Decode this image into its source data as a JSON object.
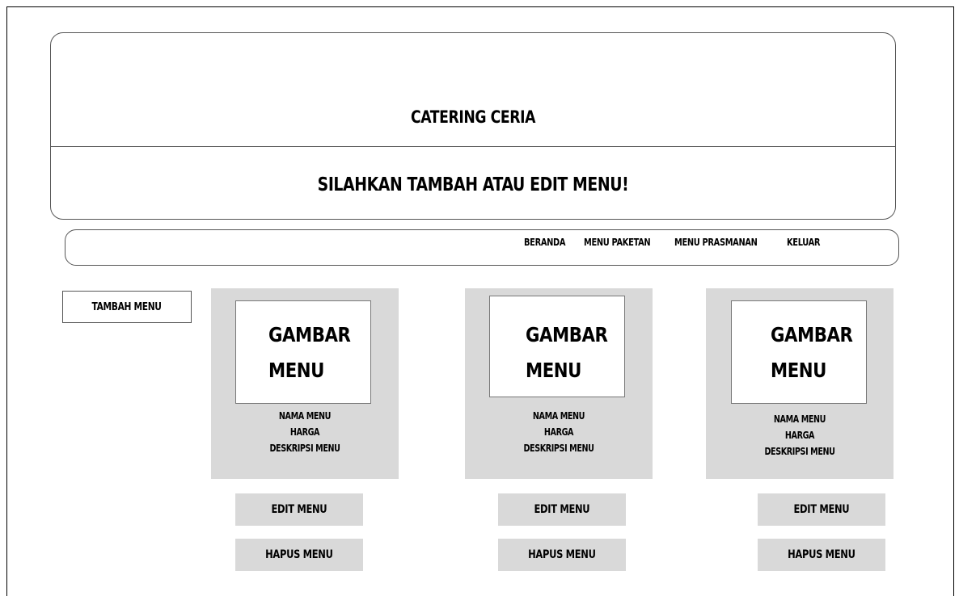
{
  "header": {
    "title": "CATERING CERIA",
    "subtitle": "SILAHKAN TAMBAH ATAU EDIT MENU!"
  },
  "nav": {
    "items": [
      {
        "label": "BERANDA"
      },
      {
        "label": "MENU PAKETAN"
      },
      {
        "label": "MENU PRASMANAN"
      },
      {
        "label": "KELUAR"
      }
    ]
  },
  "add_button": {
    "label": "TAMBAH MENU"
  },
  "cards": [
    {
      "image_label": "GAMBAR\nMENU",
      "name": "NAMA MENU",
      "price": "HARGA",
      "description": "DESKRIPSI MENU",
      "edit_label": "EDIT MENU",
      "delete_label": "HAPUS MENU"
    },
    {
      "image_label": "GAMBAR\nMENU",
      "name": "NAMA MENU",
      "price": "HARGA",
      "description": "DESKRIPSI MENU",
      "edit_label": "EDIT MENU",
      "delete_label": "HAPUS MENU"
    },
    {
      "image_label": "GAMBAR\nMENU",
      "name": "NAMA MENU",
      "price": "HARGA",
      "description": "DESKRIPSI MENU",
      "edit_label": "EDIT MENU",
      "delete_label": "HAPUS MENU"
    }
  ]
}
